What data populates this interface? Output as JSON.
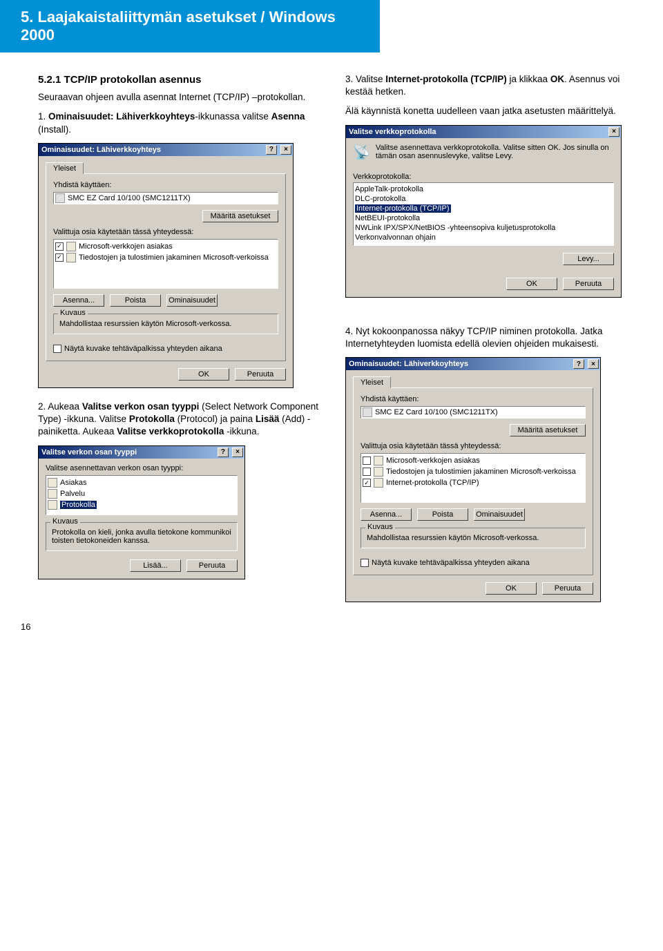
{
  "header": "5. Laajakaistaliittymän asetukset / Windows 2000",
  "left": {
    "subsection": "5.2.1 TCP/IP protokollan asennus",
    "intro": "Seuraavan ohjeen avulla asennat Internet (TCP/IP) –protokollan.",
    "step1_a": "1. ",
    "step1_b": "Ominaisuudet: Lähiverkkoyhteys",
    "step1_c": "-ikkunassa valitse ",
    "step1_d": "Asenna",
    "step1_e": " (Install).",
    "step2_a": "2. Aukeaa ",
    "step2_b": "Valitse verkon osan tyyppi",
    "step2_c": " (Select Network Component Type) -ikkuna. Valitse ",
    "step2_d": "Protokolla",
    "step2_e": " (Protocol) ja paina ",
    "step2_f": "Lisää",
    "step2_g": " (Add) -painiketta. Aukeaa ",
    "step2_h": "Valitse verkkoprotokolla",
    "step2_i": " -ikkuna."
  },
  "right": {
    "step3_a": "3. Valitse ",
    "step3_b": "Internet-protokolla (TCP/IP)",
    "step3_c": " ja klikkaa ",
    "step3_d": "OK",
    "step3_e": ". Asennus voi kestää hetken.",
    "warn": "Älä käynnistä konetta uudelleen vaan jatka asetusten määrittelyä.",
    "step4": "4. Nyt kokoonpanossa näkyy TCP/IP niminen protokolla. Jatka Internetyhteyden luomista edellä olevien ohjeiden mukaisesti."
  },
  "dlg1": {
    "title": "Ominaisuudet: Lähiverkkoyhteys",
    "tab": "Yleiset",
    "connect_lbl": "Yhdistä käyttäen:",
    "adapter": "SMC EZ Card 10/100 (SMC1211TX)",
    "btn_cfg": "Määritä asetukset",
    "items_lbl": "Valittuja osia käytetään tässä yhteydessä:",
    "item1": "Microsoft-verkkojen asiakas",
    "item2": "Tiedostojen ja tulostimien jakaminen Microsoft-verkoissa",
    "btn_install": "Asenna...",
    "btn_remove": "Poista",
    "btn_props": "Ominaisuudet",
    "grp": "Kuvaus",
    "grp_txt": "Mahdollistaa resurssien käytön Microsoft-verkossa.",
    "show_icon": "Näytä kuvake tehtäväpalkissa yhteyden aikana",
    "ok": "OK",
    "cancel": "Peruuta"
  },
  "dlg2": {
    "title": "Valitse verkon osan tyyppi",
    "lbl": "Valitse asennettavan verkon osan tyyppi:",
    "opt1": "Asiakas",
    "opt2": "Palvelu",
    "opt3": "Protokolla",
    "grp": "Kuvaus",
    "grp_txt": "Protokolla on kieli, jonka avulla tietokone kommunikoi toisten tietokoneiden kanssa.",
    "add": "Lisää...",
    "cancel": "Peruuta"
  },
  "dlg3": {
    "title": "Valitse verkkoprotokolla",
    "hint": "Valitse asennettava verkkoprotokolla. Valitse sitten OK. Jos sinulla on tämän osan asennuslevyke, valitse Levy.",
    "list_lbl": "Verkkoprotokolla:",
    "o1": "AppleTalk-protokolla",
    "o2": "DLC-protokolla",
    "o3": "Internet-protokolla (TCP/IP)",
    "o4": "NetBEUI-protokolla",
    "o5": "NWLink IPX/SPX/NetBIOS -yhteensopiva kuljetusprotokolla",
    "o6": "Verkonvalvonnan ohjain",
    "disk": "Levy...",
    "ok": "OK",
    "cancel": "Peruuta"
  },
  "dlg4": {
    "title": "Ominaisuudet: Lähiverkkoyhteys",
    "tab": "Yleiset",
    "connect_lbl": "Yhdistä käyttäen:",
    "adapter": "SMC EZ Card 10/100 (SMC1211TX)",
    "btn_cfg": "Määritä asetukset",
    "items_lbl": "Valittuja osia käytetään tässä yhteydessä:",
    "i1": "Microsoft-verkkojen asiakas",
    "i2": "Tiedostojen ja tulostimien jakaminen Microsoft-verkoissa",
    "i3": "Internet-protokolla (TCP/IP)",
    "btn_install": "Asenna...",
    "btn_remove": "Poista",
    "btn_props": "Ominaisuudet",
    "grp": "Kuvaus",
    "grp_txt": "Mahdollistaa resurssien käytön Microsoft-verkossa.",
    "show_icon": "Näytä kuvake tehtäväpalkissa yhteyden aikana",
    "ok": "OK",
    "cancel": "Peruuta"
  },
  "page_num": "16"
}
